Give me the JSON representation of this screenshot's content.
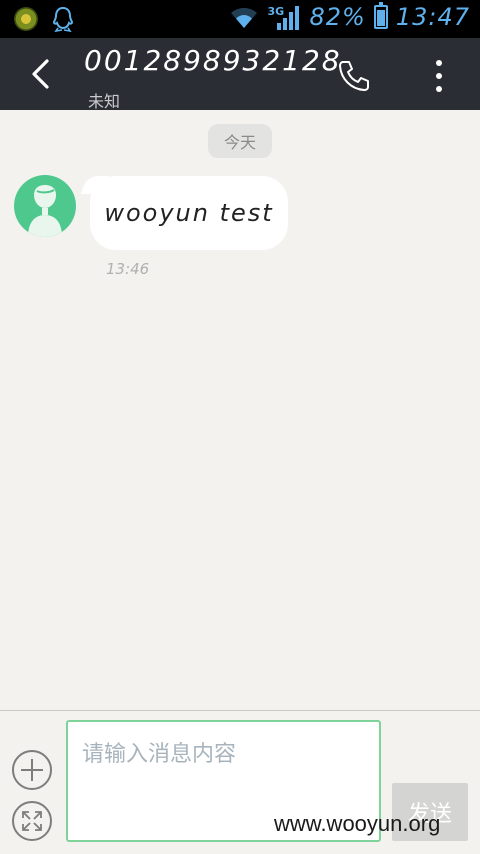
{
  "status_bar": {
    "network_type": "3G",
    "battery_percent": "82%",
    "battery_level": 0.82,
    "time": "13:47",
    "icons": [
      "app-notification-icon",
      "qq-icon",
      "wifi-icon",
      "signal-icon",
      "battery-icon"
    ],
    "accent_color": "#5fb1ee"
  },
  "header": {
    "contact_number": "0012898932128",
    "contact_status": "未知",
    "icons": [
      "back-arrow-icon",
      "phone-icon",
      "more-vertical-icon"
    ]
  },
  "conversation": {
    "date_separator": "今天",
    "messages": [
      {
        "text": "wooyun test",
        "time": "13:46",
        "direction": "incoming",
        "avatar": "person-avatar-icon",
        "avatar_color": "#4fc88e"
      }
    ]
  },
  "composer": {
    "placeholder": "请输入消息内容",
    "value": "",
    "send_label": "发送",
    "icons": [
      "add-icon",
      "expand-icon"
    ],
    "border_color": "#7fd39a"
  },
  "watermark": "www.wooyun.org"
}
